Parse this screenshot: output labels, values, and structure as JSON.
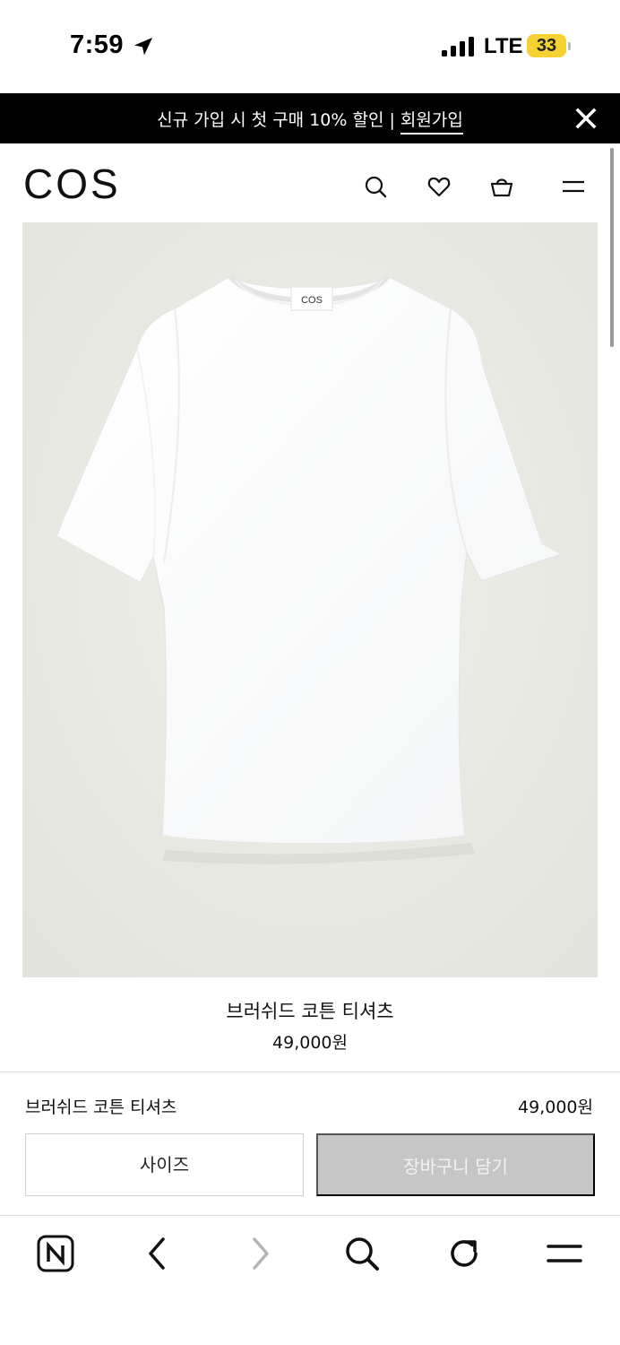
{
  "status_bar": {
    "time": "7:59",
    "network": "LTE",
    "battery": "33",
    "icons": [
      "location-arrow-icon",
      "signal-bars-icon",
      "battery-icon"
    ]
  },
  "promo": {
    "text": "신규 가입 시 첫 구매 10% 할인 | ",
    "link": "회원가입",
    "close_icon": "close-icon"
  },
  "header": {
    "logo": "COS",
    "icons": [
      "search-icon",
      "heart-icon",
      "shopping-bag-icon",
      "menu-icon"
    ]
  },
  "product": {
    "name": "브러쉬드 코튼 티셔츠",
    "price": "49,000원",
    "image_label": "COS"
  },
  "purchase_bar": {
    "name": "브러쉬드 코튼 티셔츠",
    "price": "49,000원",
    "size_label": "사이즈",
    "cart_label": "장바구니 담기"
  },
  "browser_toolbar": {
    "icons": [
      "naver-home-icon",
      "back-icon",
      "forward-icon",
      "search-icon",
      "reload-icon",
      "menu-icon"
    ]
  },
  "colors": {
    "promo_bg": "#000000",
    "image_bg": "#ebebe6",
    "cart_disabled": "#c6c6c6",
    "battery": "#f5d131"
  }
}
